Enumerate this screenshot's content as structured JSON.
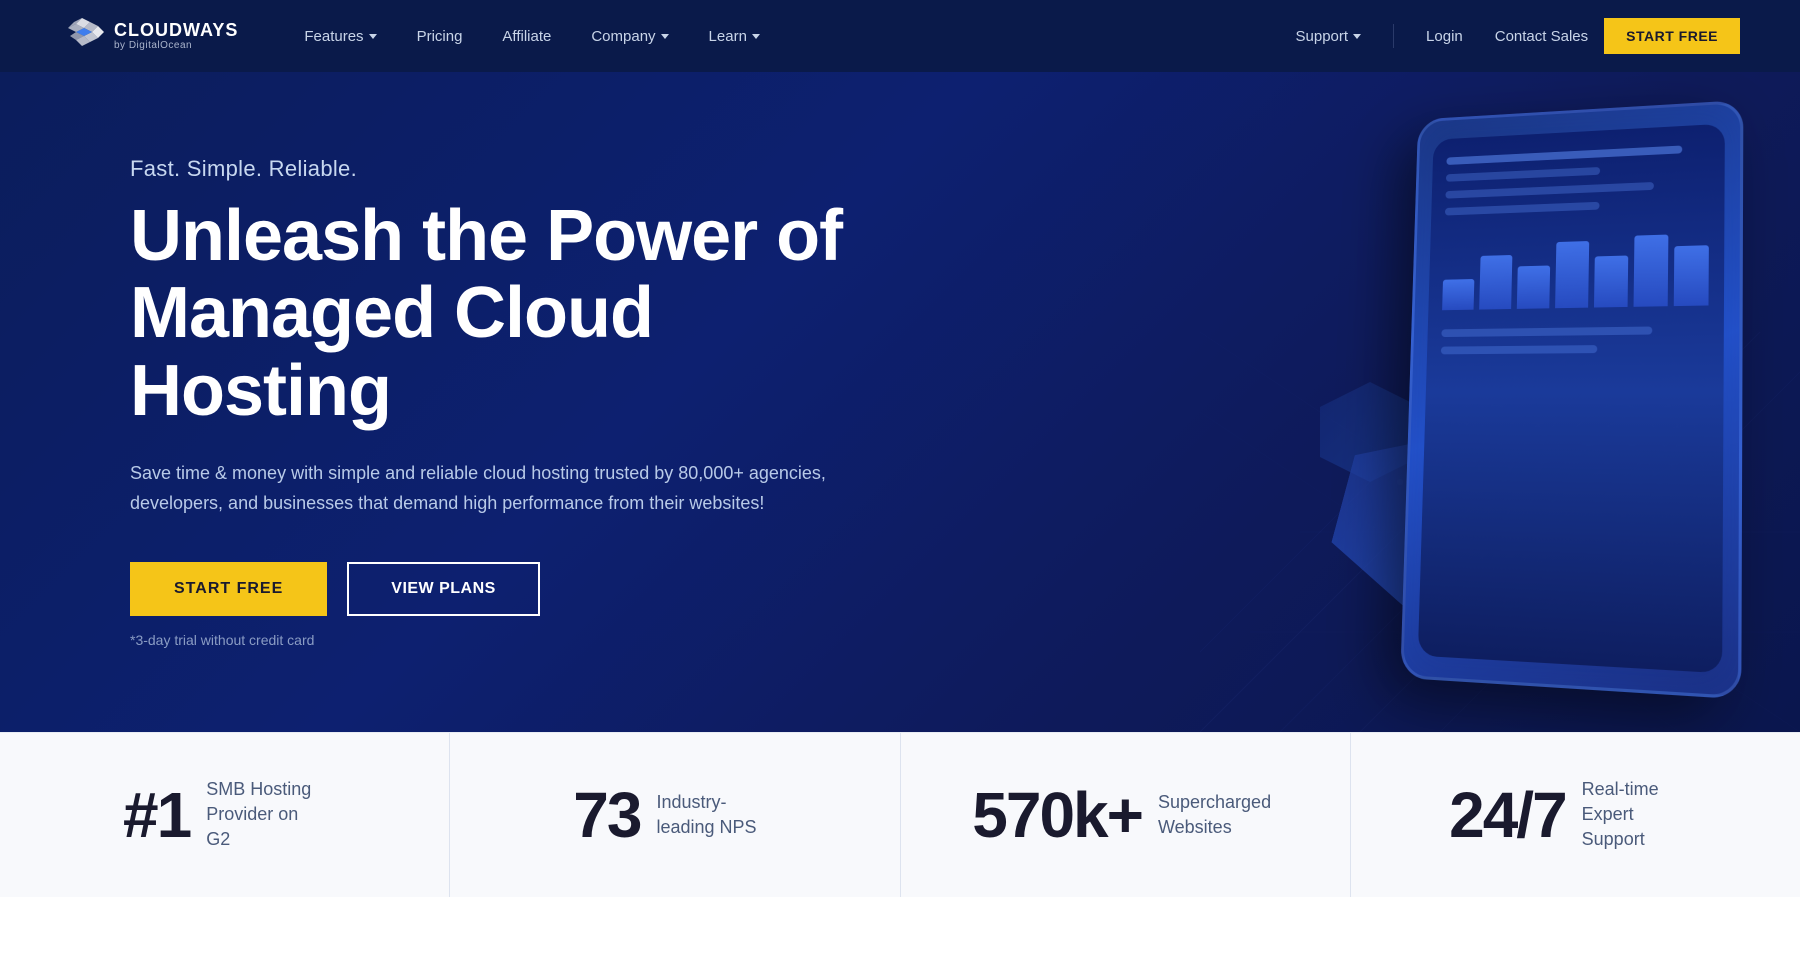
{
  "brand": {
    "name": "CLOUDWAYS",
    "sub": "by DigitalOcean"
  },
  "nav": {
    "links": [
      {
        "label": "Features",
        "has_dropdown": true
      },
      {
        "label": "Pricing",
        "has_dropdown": false
      },
      {
        "label": "Affiliate",
        "has_dropdown": false
      },
      {
        "label": "Company",
        "has_dropdown": true
      },
      {
        "label": "Learn",
        "has_dropdown": true
      }
    ],
    "right": {
      "support_label": "Support",
      "login_label": "Login",
      "contact_label": "Contact Sales",
      "start_free_label": "START FREE"
    }
  },
  "hero": {
    "tagline": "Fast. Simple. Reliable.",
    "title_line1": "Unleash the Power of",
    "title_line2": "Managed Cloud Hosting",
    "description": "Save time & money with simple and reliable cloud hosting trusted by 80,000+ agencies, developers, and businesses that demand high performance from their websites!",
    "btn_start": "START FREE",
    "btn_plans": "VIEW PLANS",
    "trial_note": "*3-day trial without credit card"
  },
  "stats": [
    {
      "number": "#1",
      "desc": "SMB Hosting Provider on G2"
    },
    {
      "number": "73",
      "desc": "Industry-leading NPS"
    },
    {
      "number": "570k+",
      "desc": "Supercharged Websites"
    },
    {
      "number": "24/7",
      "desc": "Real-time Expert Support"
    }
  ],
  "chart_bars": [
    {
      "height": "40%"
    },
    {
      "height": "70%"
    },
    {
      "height": "55%"
    },
    {
      "height": "85%"
    },
    {
      "height": "65%"
    },
    {
      "height": "90%"
    },
    {
      "height": "75%"
    }
  ]
}
